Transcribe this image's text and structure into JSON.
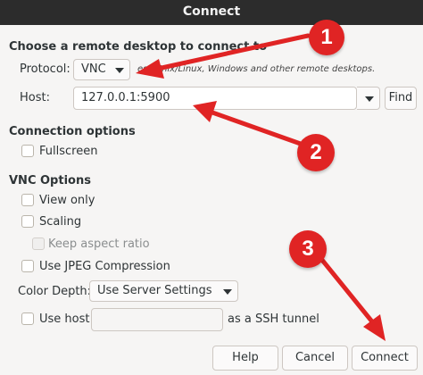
{
  "window": {
    "title": "Connect"
  },
  "main_heading": "Choose a remote desktop to connect to",
  "protocol": {
    "label": "Protocol:",
    "value": "VNC",
    "description": "ess Unix/Linux, Windows and other remote desktops."
  },
  "host": {
    "label": "Host:",
    "value": "127.0.0.1:5900",
    "find_label": "Find"
  },
  "connection_options": {
    "heading": "Connection options",
    "fullscreen_label": "Fullscreen"
  },
  "vnc_options": {
    "heading": "VNC Options",
    "view_only_label": "View only",
    "scaling_label": "Scaling",
    "keep_aspect_label": "Keep aspect ratio",
    "jpeg_label": "Use JPEG Compression",
    "color_depth_label": "Color Depth:",
    "color_depth_value": "Use Server Settings",
    "use_host_label": "Use host",
    "use_host_value": "",
    "ssh_tunnel_label": "as a SSH tunnel"
  },
  "buttons": {
    "help": "Help",
    "cancel": "Cancel",
    "connect": "Connect"
  },
  "annotations": {
    "badge_1": "1",
    "badge_2": "2",
    "badge_3": "3",
    "color": "#e02424"
  }
}
